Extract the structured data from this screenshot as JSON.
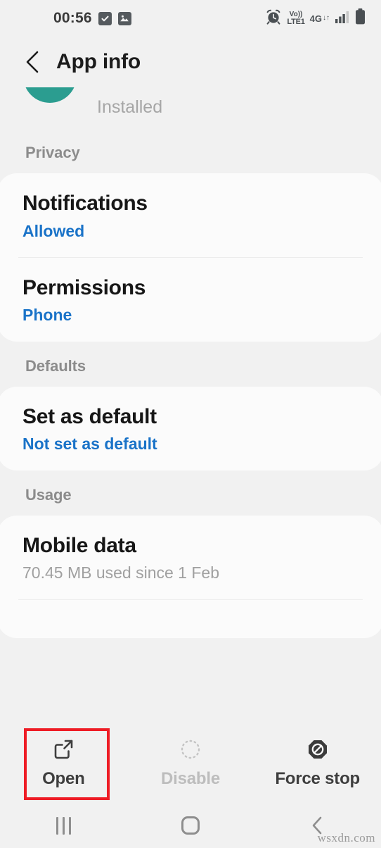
{
  "status_bar": {
    "clock": "00:56",
    "left_icons": [
      "checkbox-checked-icon",
      "image-icon"
    ],
    "alarm_icon": "alarm-clock-icon",
    "volte_top": "Vo))",
    "volte_bottom": "LTE1",
    "network_type": "4G",
    "data_arrows": "↓↑",
    "signal_icon": "signal-bars-icon",
    "battery_icon": "battery-full-icon"
  },
  "app_bar": {
    "back_icon": "back-chevron-icon",
    "title": "App info"
  },
  "clipped": {
    "app_icon": "app-icon-teal",
    "status_text": "Installed"
  },
  "sections": [
    {
      "header": "Privacy",
      "rows": [
        {
          "title": "Notifications",
          "subtitle": "Allowed",
          "subtitle_style": "link"
        },
        {
          "title": "Permissions",
          "subtitle": "Phone",
          "subtitle_style": "link"
        }
      ]
    },
    {
      "header": "Defaults",
      "rows": [
        {
          "title": "Set as default",
          "subtitle": "Not set as default",
          "subtitle_style": "link"
        }
      ]
    },
    {
      "header": "Usage",
      "rows": [
        {
          "title": "Mobile data",
          "subtitle": "70.45 MB used since 1 Feb",
          "subtitle_style": "muted"
        }
      ]
    }
  ],
  "actions": [
    {
      "label": "Open",
      "icon": "open-external-icon",
      "disabled": false,
      "highlighted": true
    },
    {
      "label": "Disable",
      "icon": "disable-dashed-circle-icon",
      "disabled": true,
      "highlighted": false
    },
    {
      "label": "Force stop",
      "icon": "force-stop-block-icon",
      "disabled": false,
      "highlighted": false
    }
  ],
  "nav_bar": {
    "recents": "recents-icon",
    "home": "home-icon",
    "back": "back-icon"
  },
  "watermark": "wsxdn.com",
  "colors": {
    "background": "#f1f1f1",
    "card": "#fbfbfb",
    "link": "#1a73c8",
    "section_header": "#8c8c8c",
    "highlight": "#ee1c25",
    "app_icon": "#2b9d90"
  }
}
